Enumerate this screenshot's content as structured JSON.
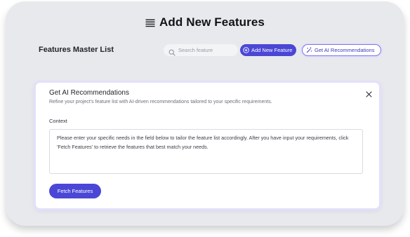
{
  "header": {
    "title": "Add New Features",
    "title_icon": "list-lines-icon"
  },
  "toolbar": {
    "master_list_label": "Features Master List",
    "search_placeholder": "Search feature",
    "search_value": "",
    "add_button_label": "Add New Feature",
    "ai_button_label": "Get AI Recommendations"
  },
  "modal": {
    "title": "Get AI Recommendations",
    "subtitle": "Refine your project's feature list with AI-driven recommendations tailored to your specific requirements.",
    "context_label": "Context",
    "context_text": "Please enter your specific needs in the field below to tailor the feature list accordingly. After you have input your requirements, click 'Fetch Features' to retrieve the features that best match your needs.",
    "fetch_button_label": "Fetch Features"
  },
  "colors": {
    "accent": "#4b47d6",
    "frame_bg": "#e8e9ec",
    "ai_border": "#7a76e8"
  }
}
